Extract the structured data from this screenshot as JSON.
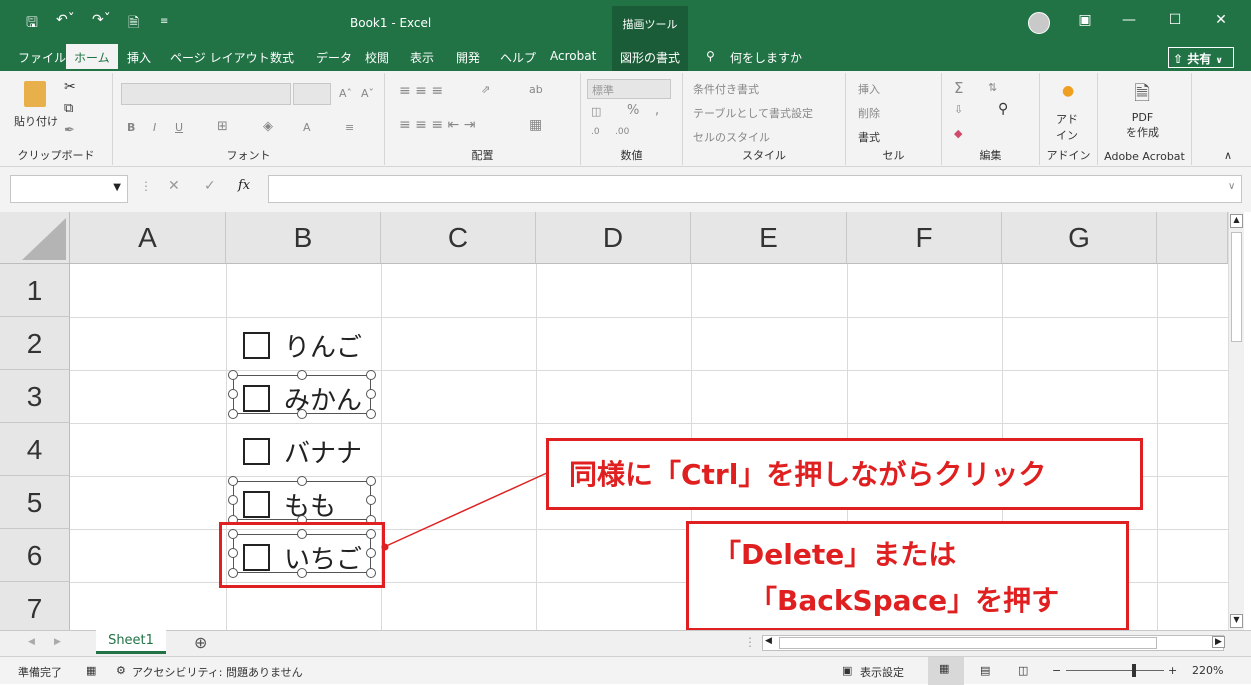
{
  "titlebar": {
    "title": "Book1  -  Excel",
    "context_tab": "描画ツール"
  },
  "menu": {
    "file": "ファイル",
    "home": "ホーム",
    "insert": "挿入",
    "page_layout": "ページ レイアウト",
    "formulas": "数式",
    "data": "データ",
    "review": "校閲",
    "view": "表示",
    "developer": "開発",
    "help": "ヘルプ",
    "acrobat": "Acrobat",
    "shape_format": "図形の書式",
    "tell_me": "何をしますか",
    "share": "共有"
  },
  "ribbon": {
    "clipboard": {
      "paste": "貼り付け",
      "label": "クリップボード"
    },
    "font": {
      "label": "フォント"
    },
    "alignment": {
      "label": "配置"
    },
    "number": {
      "format": "標準",
      "label": "数値"
    },
    "styles": {
      "conditional": "条件付き書式",
      "table": "テーブルとして書式設定",
      "cell_styles": "セルのスタイル",
      "label": "スタイル"
    },
    "cells": {
      "insert": "挿入",
      "delete": "削除",
      "format": "書式",
      "label": "セル"
    },
    "editing": {
      "label": "編集"
    },
    "addins": {
      "button": "アド\nイン",
      "label": "アドイン"
    },
    "acrobat": {
      "button": "PDF\nを作成",
      "label": "Adobe Acrobat"
    }
  },
  "formula_bar": {
    "fx": "fx",
    "value": ""
  },
  "columns": [
    "A",
    "B",
    "C",
    "D",
    "E",
    "F",
    "G"
  ],
  "rows": [
    "1",
    "2",
    "3",
    "4",
    "5",
    "6",
    "7"
  ],
  "checkboxes": [
    {
      "label": "りんご",
      "selected": false
    },
    {
      "label": "みかん",
      "selected": true
    },
    {
      "label": "バナナ",
      "selected": false
    },
    {
      "label": "もも",
      "selected": true
    },
    {
      "label": "いちご",
      "selected": true
    }
  ],
  "callouts": {
    "ctrl_click": "同様に「Ctrl」を押しながらクリック",
    "delete_line1": "「Delete」または",
    "delete_line2": "「BackSpace」を押す"
  },
  "colors": {
    "excel_green": "#217346",
    "callout_red": "#e02020"
  },
  "sheet": {
    "tab": "Sheet1"
  },
  "status": {
    "ready": "準備完了",
    "accessibility": "アクセシビリティ: 問題ありません",
    "display_settings": "表示設定",
    "zoom": "220%"
  }
}
